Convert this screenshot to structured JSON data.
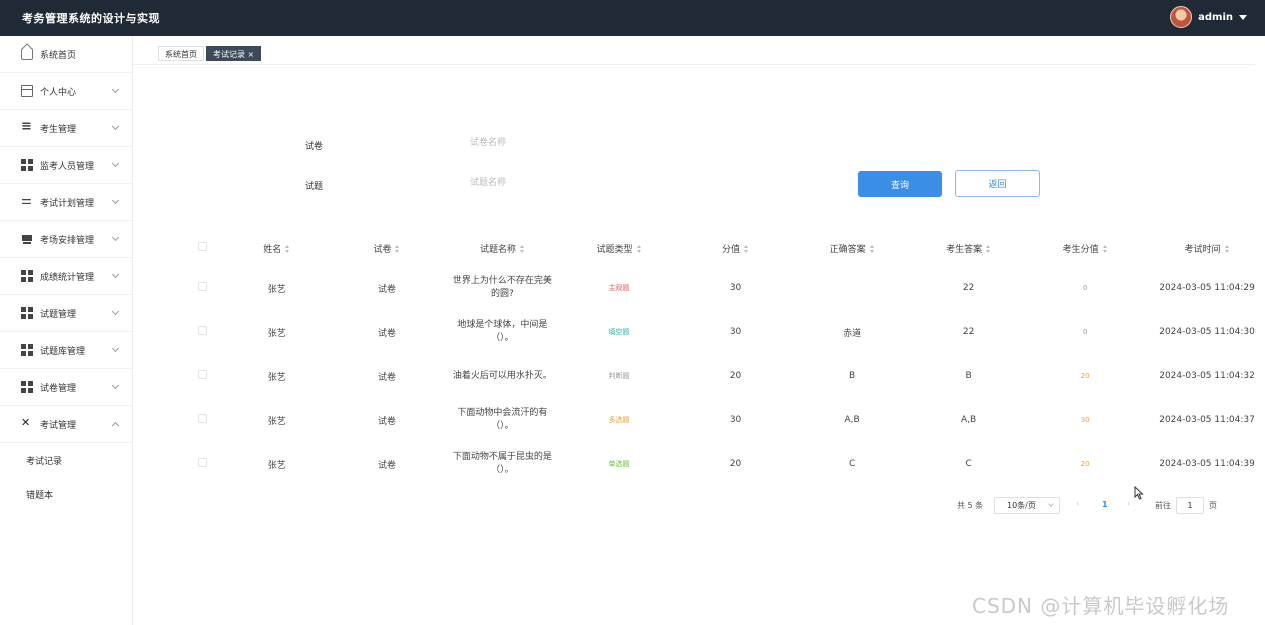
{
  "header": {
    "title": "考务管理系统的设计与实现",
    "user": "admin"
  },
  "sidebar": {
    "items": [
      {
        "label": "系统首页"
      },
      {
        "label": "个人中心"
      },
      {
        "label": "考生管理"
      },
      {
        "label": "监考人员管理"
      },
      {
        "label": "考试计划管理"
      },
      {
        "label": "考场安排管理"
      },
      {
        "label": "成绩统计管理"
      },
      {
        "label": "试题管理"
      },
      {
        "label": "试题库管理"
      },
      {
        "label": "试卷管理"
      },
      {
        "label": "考试管理"
      }
    ],
    "sub_items": [
      {
        "label": "考试记录"
      },
      {
        "label": "错题本"
      }
    ]
  },
  "tabs": [
    {
      "label": "系统首页"
    },
    {
      "label": "考试记录 ×"
    }
  ],
  "search": {
    "paper_label": "试卷",
    "paper_placeholder": "试卷名称",
    "question_label": "试题",
    "question_placeholder": "试题名称",
    "query_button": "查询",
    "back_button": "返回"
  },
  "table": {
    "columns": [
      "姓名",
      "试卷",
      "试题名称",
      "试题类型",
      "分值",
      "正确答案",
      "考生答案",
      "考生分值",
      "考试时间"
    ],
    "rows": [
      {
        "name": "张艺",
        "paper": "试卷",
        "question": "世界上为什么不存在完美的圆?",
        "type": "主观题",
        "type_color": "#e05a5a",
        "score": "30",
        "correct": "",
        "answer": "22",
        "got": "0",
        "got_color": "#999999",
        "time": "2024-03-05 11:04:29"
      },
      {
        "name": "张艺",
        "paper": "试卷",
        "question": "地球是个球体，中间是（）。",
        "type": "填空题",
        "type_color": "#27b39c",
        "score": "30",
        "correct": "赤道",
        "answer": "22",
        "got": "0",
        "got_color": "#999999",
        "time": "2024-03-05 11:04:30"
      },
      {
        "name": "张艺",
        "paper": "试卷",
        "question": "油着火后可以用水扑灭。",
        "type": "判断题",
        "type_color": "#999999",
        "score": "20",
        "correct": "B",
        "answer": "B",
        "got": "20",
        "got_color": "#e6a23c",
        "time": "2024-03-05 11:04:32"
      },
      {
        "name": "张艺",
        "paper": "试卷",
        "question": "下面动物中会流汗的有（）。",
        "type": "多选题",
        "type_color": "#e6a23c",
        "score": "30",
        "correct": "A,B",
        "answer": "A,B",
        "got": "30",
        "got_color": "#e6a23c",
        "time": "2024-03-05 11:04:37"
      },
      {
        "name": "张艺",
        "paper": "试卷",
        "question": "下面动物不属于昆虫的是（）。",
        "type": "单选题",
        "type_color": "#67c23a",
        "score": "20",
        "correct": "C",
        "answer": "C",
        "got": "20",
        "got_color": "#e6a23c",
        "time": "2024-03-05 11:04:39"
      }
    ]
  },
  "pagination": {
    "total": "共 5 条",
    "page_size": "10条/页",
    "current": "1",
    "goto_label": "前往",
    "goto_value": "1",
    "page_unit": "页",
    "active_color": "#3a8ee6"
  },
  "watermark": "CSDN @计算机毕设孵化场"
}
